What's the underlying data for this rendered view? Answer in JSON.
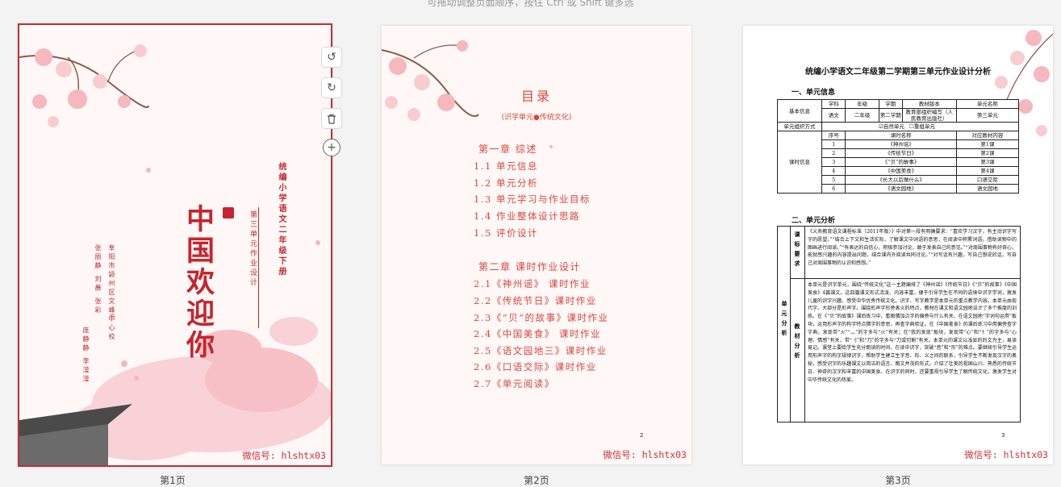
{
  "hint": "可拖动调整页面顺序，按住 Ctrl 或 Shift 键多选",
  "watermark": "微信号: hlshtx03",
  "pages": {
    "p1": {
      "label": "第1页",
      "welcome": "中国欢迎你",
      "series": "统编小学语文二年级下册",
      "unit": "第三单元作业设计",
      "org": "阜阳市颍州区文峰中心校",
      "authors_line1": "张丽静 刘晨 张彩",
      "authors_line2": "庞静静 李滢滢"
    },
    "p2": {
      "label": "第2页",
      "title": "目录",
      "subtitle": "(识字单元●传统文化)",
      "chapter1": "第一章  综述",
      "items1": [
        "1.1  单元信息",
        "1.2  单元分析",
        "1.3  单元学习与作业目标",
        "1.4  作业整体设计思路",
        "1.5  评价设计"
      ],
      "chapter2": "第二章  课时作业设计",
      "items2": [
        "2.1《神州谣》 课时作业",
        "2.2《传统节日》课时作业",
        "2.3《“贝”的故事》课时作业",
        "2.4《中国美食》 课时作业",
        "2.5《语文园地三》课时作业",
        "2.6《口语交际》课时作业",
        "2.7《单元阅读》"
      ],
      "page_no": "2"
    },
    "p3": {
      "label": "第3页",
      "title": "统编小学语文二年级第二学期第三单元作业设计分析",
      "sec1": "一、单元信息",
      "sec2": "二、单元分析",
      "page_no": "3",
      "info": {
        "basic": "基本信息",
        "h_subject": "学科",
        "h_grade": "年级",
        "h_term": "学期",
        "h_textbook": "教材版本",
        "h_unit": "单元名称",
        "v_subject": "语文",
        "v_grade": "二年级",
        "v_term": "第二学期",
        "v_textbook": "教育部组织编写（人民教育出版社）",
        "v_unit": "第三单元",
        "org_label": "单元组织方式",
        "natural": "☑自然单元",
        "rebuild": "☐重组单元",
        "lesson_label": "课时信息",
        "h_no": "序号",
        "h_name": "课时名称",
        "h_content": "对应教材内容",
        "rows": [
          [
            "1",
            "《神州谣》",
            "第1课"
          ],
          [
            "2",
            "《传统节日》",
            "第2课"
          ],
          [
            "3",
            "《“贝”的故事》",
            "第3课"
          ],
          [
            "4",
            "《中国美食》",
            "第4课"
          ],
          [
            "5",
            "《长大以后做什么》",
            "口语交际"
          ],
          [
            "6",
            "《语文园地》",
            "语文园地"
          ]
        ]
      },
      "analysis": {
        "outer_label": "单元分析",
        "label_standard": "课标要求",
        "label_textbook": "教材分析",
        "text_standard": "《义务教育语文课程标准（2011年版）》中对第一段有明确要求：“喜欢学习汉字，有主动识字写字的愿望。”“结合上下文和生活实际，了解课文中词语的意思，在阅读中积累词语。借助读物中的图画进行阅读。”“有表达的自信心，积极参加讨论，敢于发表自己的意见。”“对周围事物有好奇心，能就感兴趣的内容提出问题，结合课内外阅读共同讨论。”“对写话有兴趣，写自己想说的话，写自己对周围事物的认识和感想。”",
        "text_textbook": "本单元是识字单元，围绕“传统文化”这一主题编排了《神州谣》《传统节日》《“贝”的故事》《中国美食》4篇课文。这四篇课文形式活泼、内容丰富，便于引导学生在不同的语境中识字学词，激发儿童的识字兴趣，感受中华优秀传统文化。识字、写字教学是本单元的重点教学内容。本单元由现代字、大部分是形声字。围绕形声字形旁表义的特点，教材在课文和语文园地设计了多个推度的训练。在《“贝”的故事》课后练习中，看图猜加点字的偏旁与什么有关，在语文园地“字词句运用”板块，运用形声字的构字特点猜字的意思，再查字典验证。在《中国美食》的课后练习中用偏旁查字字典，发现带“火”“灬”的字多与“火”有关；在“我的发现”板块，发现带“心”和“忄”的字多与“心理、情感”有关，带“刂”和“刀”的字多与“刀或切割”有关。本单元的课文以浅显的的文为主，易读易记。课堂上要给学生充分朗读的时间，在读中识字，突破“音”和“形”的难点。要继续引导学生运用形声字的构字规律识字，帮助学生建立生字音、形、义之间的联系，引导学生不断发现汉字的奥秘，感受识字的乐趣课文以简洁的语言、图文并茂的形式，介绍了壮美的祖国山川、熟悉的传统节日、神奇的汉字和丰富的中国美食。在识字的同时，还要重视引导学生了解传统文化，激发学生对中华传统文化的热爱。"
      }
    }
  },
  "colors": {
    "accent": "#c6242e",
    "toc": "#d7463f",
    "selected_border": "#b8323a",
    "blossom": "#f6b7bf"
  }
}
